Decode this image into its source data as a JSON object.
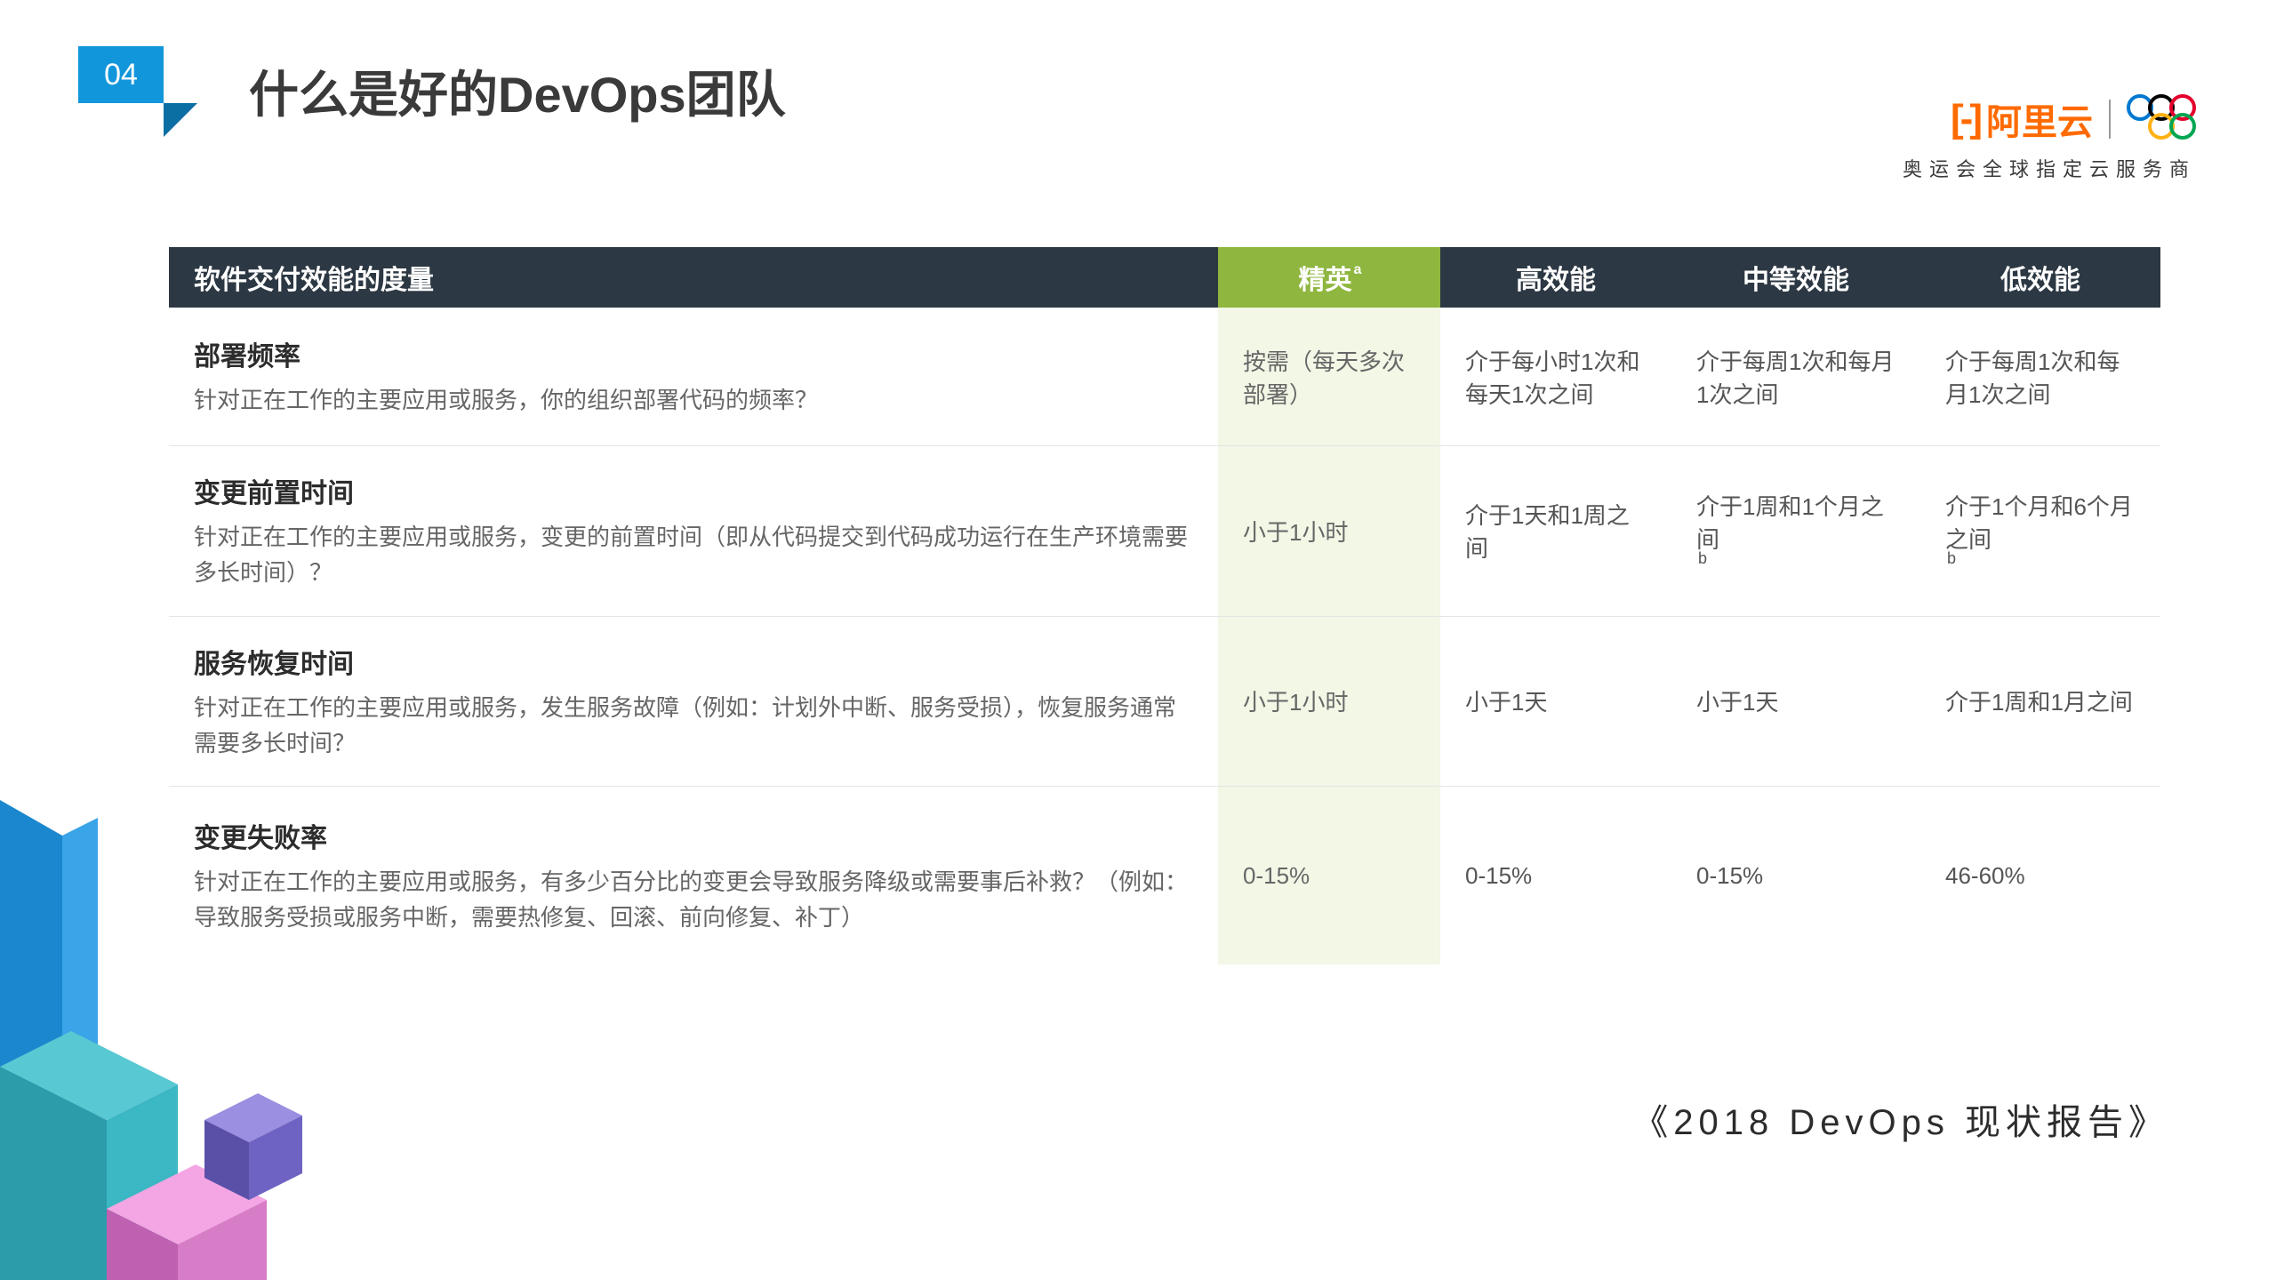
{
  "page_number": "04",
  "title": "什么是好的DevOps团队",
  "logo": {
    "brand_text": "阿里云",
    "subtitle": "奥运会全球指定云服务商"
  },
  "table": {
    "header": {
      "metric": "软件交付效能的度量",
      "elite": "精英",
      "elite_sup": "a",
      "high": "高效能",
      "mid": "中等效能",
      "low": "低效能"
    },
    "rows": [
      {
        "title": "部署频率",
        "desc": "针对正在工作的主要应用或服务，你的组织部署代码的频率？",
        "elite": "按需（每天多次部署）",
        "high": "介于每小时1次和每天1次之间",
        "mid": "介于每周1次和每月1次之间",
        "low": "介于每周1次和每月1次之间"
      },
      {
        "title": "变更前置时间",
        "desc": "针对正在工作的主要应用或服务，变更的前置时间（即从代码提交到代码成功运行在生产环境需要多长时间）？",
        "elite": "小于1小时",
        "high": "介于1天和1周之间",
        "mid": "介于1周和1个月之间 ",
        "mid_sup": "b",
        "low": "介于1个月和6个月之间 ",
        "low_sup": "b"
      },
      {
        "title": "服务恢复时间",
        "desc": "针对正在工作的主要应用或服务，发生服务故障（例如：计划外中断、服务受损），恢复服务通常需要多长时间？",
        "elite": "小于1小时",
        "high": "小于1天",
        "mid": "小于1天",
        "low": "介于1周和1月之间"
      },
      {
        "title": "变更失败率",
        "desc": "针对正在工作的主要应用或服务，有多少百分比的变更会导致服务降级或需要事后补救？（例如：导致服务受损或服务中断，需要热修复、回滚、前向修复、补丁）",
        "elite": "0-15%",
        "high": "0-15%",
        "mid": "0-15%",
        "low": "46-60%"
      }
    ]
  },
  "citation": "《2018 DevOps 现状报告》",
  "chart_data": {
    "type": "table",
    "title": "软件交付效能的度量",
    "columns": [
      "指标",
      "精英",
      "高效能",
      "中等效能",
      "低效能"
    ],
    "rows": [
      [
        "部署频率",
        "按需（每天多次部署）",
        "介于每小时1次和每天1次之间",
        "介于每周1次和每月1次之间",
        "介于每周1次和每月1次之间"
      ],
      [
        "变更前置时间",
        "小于1小时",
        "介于1天和1周之间",
        "介于1周和1个月之间",
        "介于1个月和6个月之间"
      ],
      [
        "服务恢复时间",
        "小于1小时",
        "小于1天",
        "小于1天",
        "介于1周和1月之间"
      ],
      [
        "变更失败率",
        "0-15%",
        "0-15%",
        "0-15%",
        "46-60%"
      ]
    ]
  }
}
